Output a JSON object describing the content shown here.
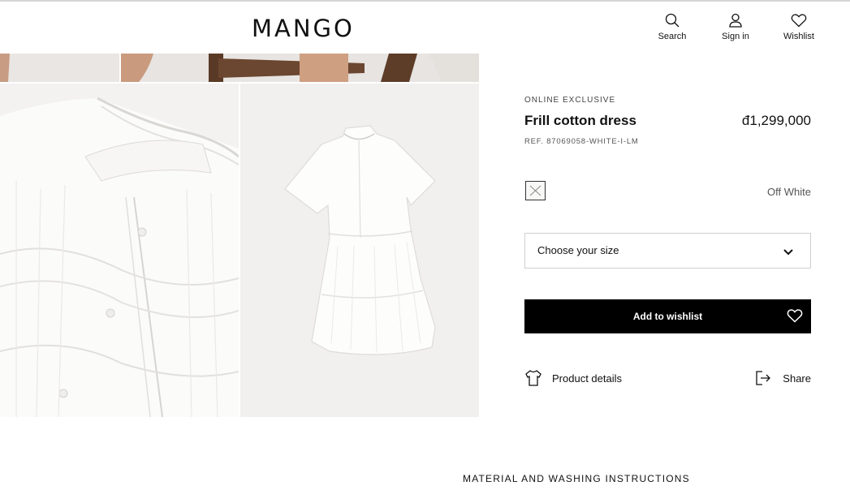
{
  "header": {
    "logo": "MANGO",
    "search_label": "Search",
    "signin_label": "Sign in",
    "wishlist_label": "Wishlist"
  },
  "product": {
    "badge": "ONLINE EXCLUSIVE",
    "name": "Frill cotton dress",
    "price": "đ1,299,000",
    "ref": "REF. 87069058-WHITE-I-LM",
    "color_name": "Off White",
    "size_placeholder": "Choose your size",
    "add_to_wishlist": "Add to wishlist",
    "product_details": "Product details",
    "share": "Share"
  },
  "section": {
    "material_title": "MATERIAL AND WASHING INSTRUCTIONS"
  },
  "icons": {
    "search": "search-icon",
    "signin": "user-icon",
    "wishlist": "heart-icon",
    "size": "chevron-down-icon",
    "details": "tshirt-icon",
    "share": "share-icon"
  },
  "colors": {
    "primary": "#000000",
    "border": "#cfcfcf",
    "muted_text": "#555555"
  }
}
